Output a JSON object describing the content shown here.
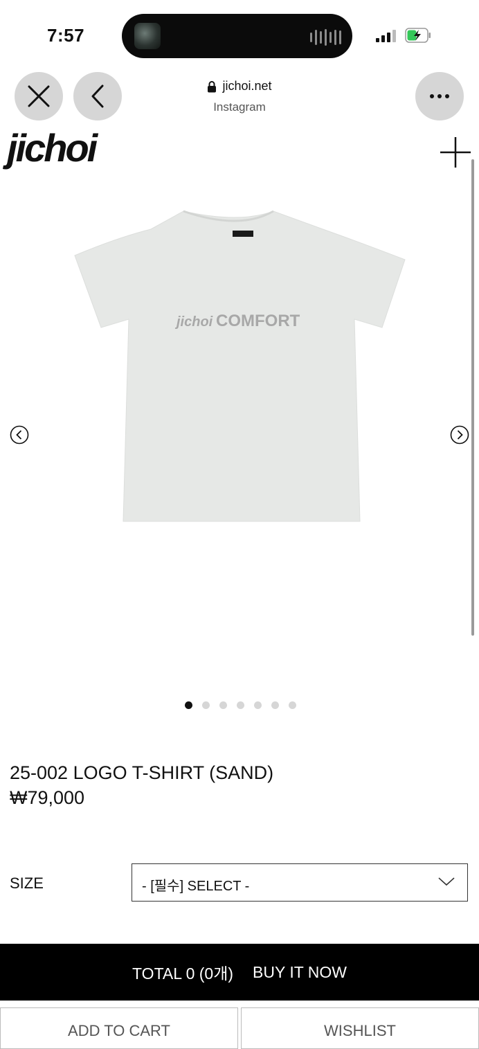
{
  "status_bar": {
    "time": "7:57"
  },
  "browser": {
    "domain": "jichoi.net",
    "source": "Instagram",
    "close_icon": "close-icon",
    "back_icon": "chevron-left-icon",
    "more_icon": "ellipsis-icon"
  },
  "shop": {
    "logo": "jichoi",
    "menu_icon": "plus-icon"
  },
  "product": {
    "print_brand": "jichoi",
    "print_word": "COMFORT",
    "name": "25-002 LOGO T-SHIRT (SAND)",
    "price": "₩79,000",
    "image_index": 1,
    "image_count": 7
  },
  "options": {
    "size_label": "SIZE",
    "size_selected": "- [필수] SELECT -"
  },
  "actions": {
    "total": "TOTAL 0 (0개)",
    "buy_now": "BUY IT NOW",
    "add_to_cart": "ADD TO CART",
    "wishlist": "WISHLIST"
  },
  "colors": {
    "accent": "#000000",
    "shirt": "#e6e8e6",
    "print": "#a8a8a8"
  }
}
